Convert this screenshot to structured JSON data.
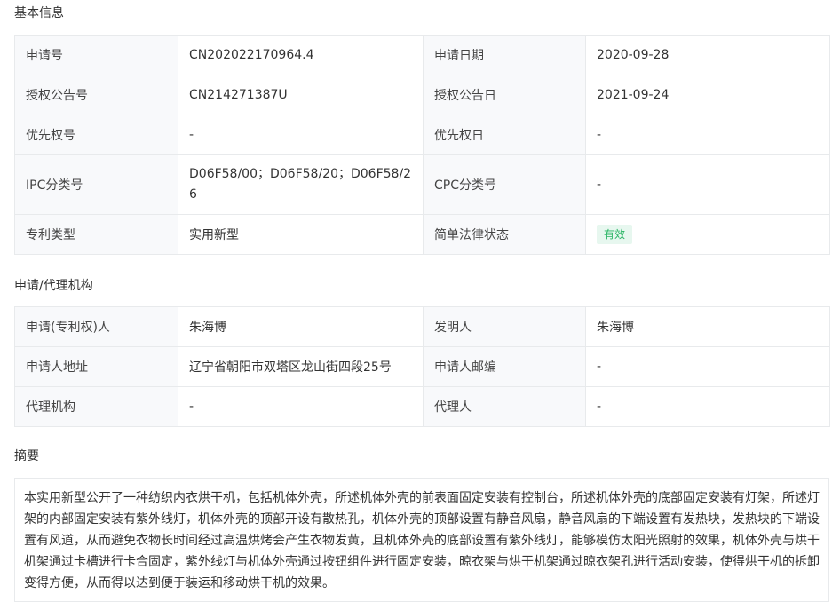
{
  "basic_info": {
    "title": "基本信息",
    "rows": [
      [
        {
          "label": "申请号",
          "value": "CN202022170964.4"
        },
        {
          "label": "申请日期",
          "value": "2020-09-28"
        }
      ],
      [
        {
          "label": "授权公告号",
          "value": "CN214271387U"
        },
        {
          "label": "授权公告日",
          "value": "2021-09-24"
        }
      ],
      [
        {
          "label": "优先权号",
          "value": "-"
        },
        {
          "label": "优先权日",
          "value": "-"
        }
      ],
      [
        {
          "label": "IPC分类号",
          "value": "D06F58/00；D06F58/20；D06F58/26"
        },
        {
          "label": "CPC分类号",
          "value": "-"
        }
      ],
      [
        {
          "label": "专利类型",
          "value": "实用新型"
        },
        {
          "label": "简单法律状态",
          "value": "有效"
        }
      ]
    ]
  },
  "agency_info": {
    "title": "申请/代理机构",
    "rows": [
      [
        {
          "label": "申请(专利权)人",
          "value": "朱海博"
        },
        {
          "label": "发明人",
          "value": "朱海博"
        }
      ],
      [
        {
          "label": "申请人地址",
          "value": "辽宁省朝阳市双塔区龙山街四段25号"
        },
        {
          "label": "申请人邮编",
          "value": "-"
        }
      ],
      [
        {
          "label": "代理机构",
          "value": "-"
        },
        {
          "label": "代理人",
          "value": "-"
        }
      ]
    ]
  },
  "abstract": {
    "title": "摘要",
    "text": "本实用新型公开了一种纺织内衣烘干机，包括机体外壳，所述机体外壳的前表面固定安装有控制台，所述机体外壳的底部固定安装有灯架，所述灯架的内部固定安装有紫外线灯，机体外壳的顶部开设有散热孔，机体外壳的顶部设置有静音风扇，静音风扇的下端设置有发热块，发热块的下端设置有风道，从而避免衣物长时间经过高温烘烤会产生衣物发黄，且机体外壳的底部设置有紫外线灯，能够模仿太阳光照射的效果，机体外壳与烘干机架通过卡槽进行卡合固定，紫外线灯与机体外壳通过按钮组件进行固定安装，晾衣架与烘干机架通过晾衣架孔进行活动安装，使得烘干机的拆卸变得方便，从而得以达到便于装运和移动烘干机的效果。"
  }
}
